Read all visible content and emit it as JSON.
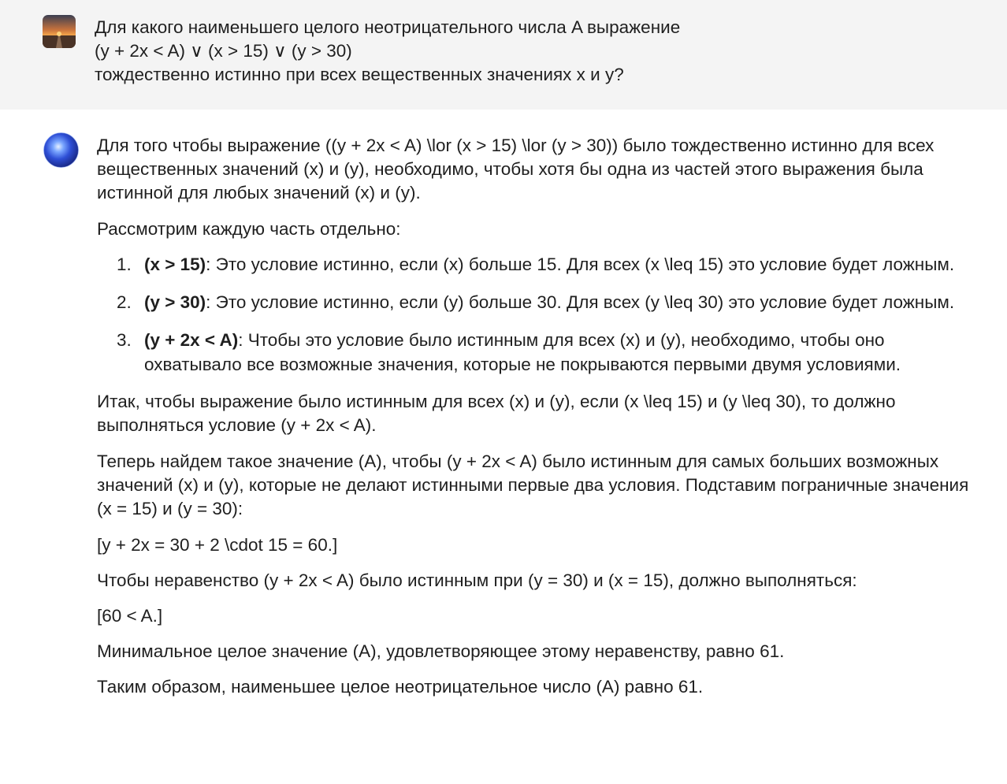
{
  "user_message": {
    "lines": [
      "Для какого наименьшего целого неотрицательного числа A выражение",
      "(y + 2x < A) ∨ (x > 15) ∨ (y > 30)",
      "тождественно истинно при всех вещественных значениях x и y?"
    ]
  },
  "assistant_message": {
    "intro": "Для того чтобы выражение ((y + 2x < A) \\lor (x > 15) \\lor (y > 30)) было тождественно истинно для всех вещественных значений (x) и (y), необходимо, чтобы хотя бы одна из частей этого выражения была истинной для любых значений (x) и (y).",
    "consider": "Рассмотрим каждую часть отдельно:",
    "items": [
      {
        "num": "1.",
        "bold": "(x > 15)",
        "text": ": Это условие истинно, если (x) больше 15. Для всех (x \\leq 15) это условие будет ложным."
      },
      {
        "num": "2.",
        "bold": "(y > 30)",
        "text": ": Это условие истинно, если (y) больше 30. Для всех (y \\leq 30) это условие будет ложным."
      },
      {
        "num": "3.",
        "bold": "(y + 2x < A)",
        "text": ": Чтобы это условие было истинным для всех (x) и (y), необходимо, чтобы оно охватывало все возможные значения, которые не покрываются первыми двумя условиями."
      }
    ],
    "so": "Итак, чтобы выражение было истинным для всех (x) и (y), если (x \\leq 15) и (y \\leq 30), то должно выполняться условие (y + 2x < A).",
    "now": "Теперь найдем такое значение (A), чтобы (y + 2x < A) было истинным для самых больших возможных значений (x) и (y), которые не делают истинными первые два условия. Подставим пограничные значения (x = 15) и (y = 30):",
    "formula1": "[y + 2x = 30 + 2 \\cdot 15 = 60.]",
    "inequality_text": "Чтобы неравенство (y + 2x < A) было истинным при (y = 30) и (x = 15), должно выполняться:",
    "formula2": "[60 < A.]",
    "minimal": "Минимальное целое значение (A), удовлетворяющее этому неравенству, равно 61.",
    "conclusion": "Таким образом, наименьшее целое неотрицательное число (A) равно 61."
  },
  "colors": {
    "user_background": "#f4f4f4",
    "text": "#1f1f1f"
  },
  "icons": {
    "user_avatar": "sunset-road-avatar",
    "assistant_avatar": "blue-orb-avatar"
  }
}
